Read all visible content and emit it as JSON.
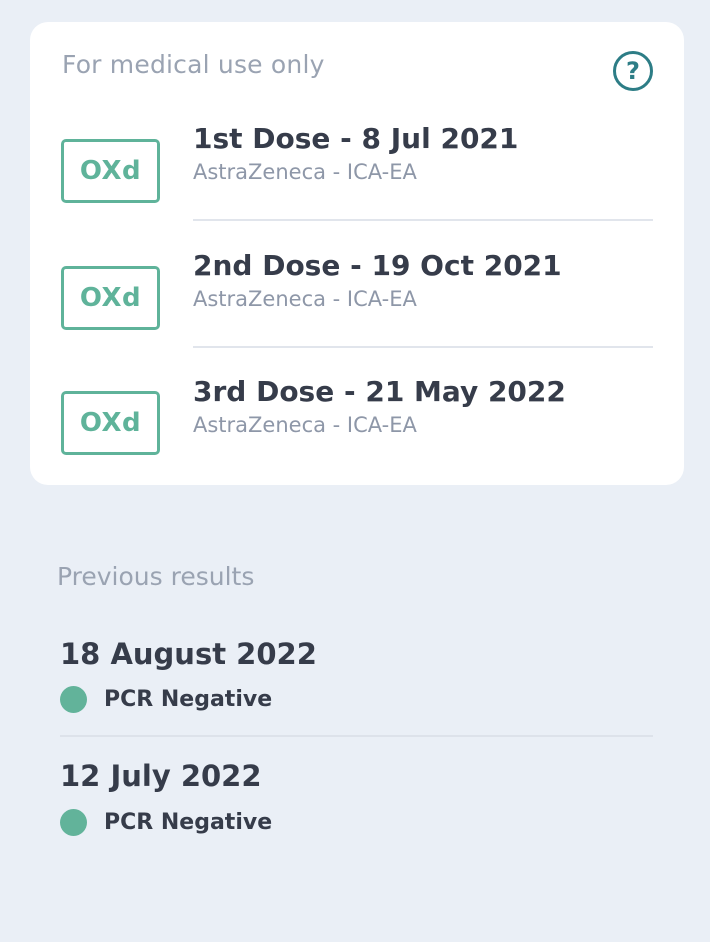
{
  "card": {
    "title": "For medical use only",
    "help_glyph": "?",
    "doses": [
      {
        "badge": "OXd",
        "title": "1st Dose - 8 Jul 2021",
        "subtitle": "AstraZeneca - ICA-EA"
      },
      {
        "badge": "OXd",
        "title": "2nd Dose - 19 Oct 2021",
        "subtitle": "AstraZeneca - ICA-EA"
      },
      {
        "badge": "OXd",
        "title": "3rd Dose - 21 May 2022",
        "subtitle": "AstraZeneca - ICA-EA"
      }
    ]
  },
  "previous": {
    "label": "Previous results",
    "results": [
      {
        "date": "18 August 2022",
        "status": "PCR Negative"
      },
      {
        "date": "12 July 2022",
        "status": "PCR Negative"
      }
    ]
  },
  "colors": {
    "accent_green": "#5fb39a",
    "help_teal": "#2d7d86",
    "background": "#eaeff6"
  },
  "icons": {
    "help": "question-circle-icon",
    "status": "status-dot-icon"
  }
}
